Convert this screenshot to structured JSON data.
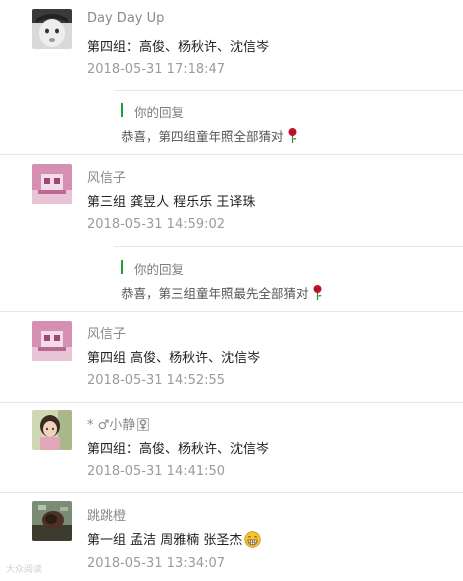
{
  "comments": [
    {
      "name": "Day Day Up",
      "text": "第四组：高俊、杨秋许、沈信岑",
      "time": "2018-05-31 17:18:47",
      "reply": {
        "label": "你的回复",
        "text": "恭喜，第四组童年照全部猜对"
      }
    },
    {
      "name": "风信子",
      "text": "第三组 龚昱人 程乐乐 王译珠",
      "time": "2018-05-31 14:59:02",
      "reply": {
        "label": "你的回复",
        "text": "恭喜，第三组童年照最先全部猜对"
      }
    },
    {
      "name": "风信子",
      "text": "第四组 高俊、杨秋许、沈信岑",
      "time": "2018-05-31 14:52:55"
    },
    {
      "name": "* ♂小静",
      "text": "第四组：高俊、杨秋许、沈信岑",
      "time": "2018-05-31 14:41:50"
    },
    {
      "name": "跳跳橙",
      "text": "第一组 孟洁 周雅楠 张圣杰",
      "time": "2018-05-31 13:34:07"
    }
  ],
  "watermark": "大众阅读",
  "colors": {
    "reply_bar": "#19a33a",
    "rose": "#c8102e",
    "divider": "#e7e7e7"
  },
  "icons": {
    "reply_emoji": "rose-icon",
    "comment_emoji": "grin-emoji-icon",
    "badge": "female-symbol-icon"
  }
}
